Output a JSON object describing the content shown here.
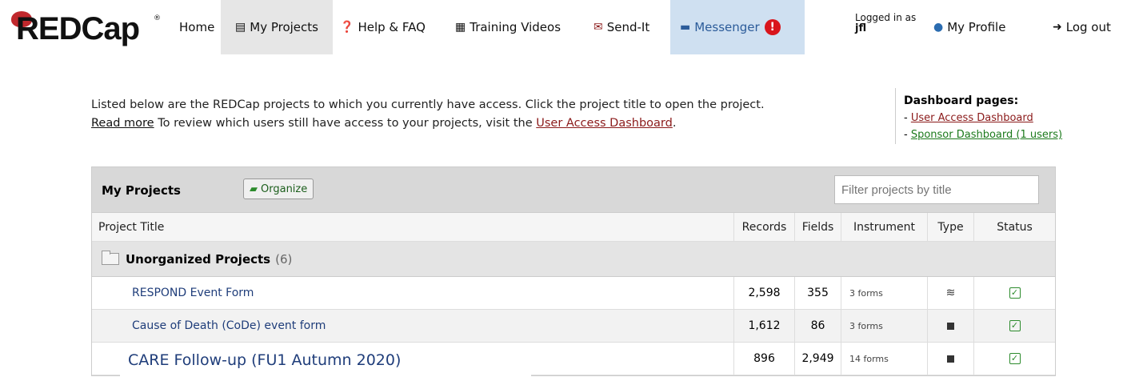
{
  "nav": {
    "logo": "REDCap",
    "logo_mark": "®",
    "home": "Home",
    "my_projects": "My Projects",
    "help": "Help & FAQ",
    "training": "Training Videos",
    "sendit": "Send-It",
    "messenger": "Messenger",
    "messenger_badge": "!",
    "logged_in_label": "Logged in as",
    "username": "jfl",
    "profile": "My Profile",
    "logout": "Log out"
  },
  "intro": {
    "text1": "Listed below are the REDCap projects to which you currently have access. Click the project title to open the project.",
    "read_more": "Read more",
    "text2": " To review which users still have access to your projects, visit the ",
    "uad_link": "User Access Dashboard",
    "text3": "."
  },
  "dashboard": {
    "title": "Dashboard pages:",
    "link1": "User Access Dashboard",
    "link2": "Sponsor Dashboard (1 users)",
    "prefix": "- "
  },
  "table": {
    "title": "My Projects",
    "organize": "Organize",
    "filter_placeholder": "Filter projects by title",
    "columns": {
      "title": "Project Title",
      "records": "Records",
      "fields": "Fields",
      "instrument": "Instrument",
      "type": "Type",
      "status": "Status"
    },
    "folder": {
      "name": "Unorganized Projects",
      "count": "(6)"
    },
    "rows": [
      {
        "title": "RESPOND Event Form",
        "records": "2,598",
        "fields": "355",
        "instrument": "3 forms",
        "type": "longitudinal-stack-icon"
      },
      {
        "title": "Cause of Death (CoDe) event form",
        "records": "1,612",
        "fields": "86",
        "instrument": "3 forms",
        "type": "classic-square-icon"
      },
      {
        "title": "CARE Follow-up (FU1 Autumn 2020)",
        "records": "896",
        "fields": "2,949",
        "instrument": "14 forms",
        "type": "classic-square-icon"
      }
    ],
    "status_check": "✓"
  },
  "colors": {
    "accent_red": "#c0282d",
    "messenger_bg": "#cfe0f1",
    "link_blue": "#1f3d7a",
    "green": "#2c8b2c"
  }
}
